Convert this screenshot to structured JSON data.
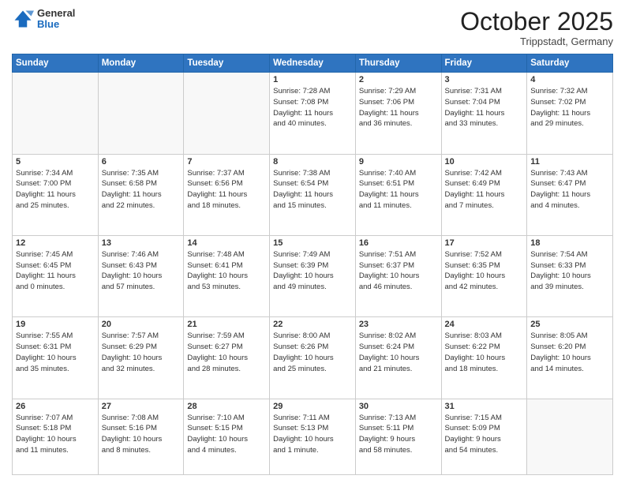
{
  "header": {
    "logo": {
      "general": "General",
      "blue": "Blue"
    },
    "title": "October 2025",
    "location": "Trippstadt, Germany"
  },
  "weekdays": [
    "Sunday",
    "Monday",
    "Tuesday",
    "Wednesday",
    "Thursday",
    "Friday",
    "Saturday"
  ],
  "weeks": [
    [
      {
        "day": "",
        "info": ""
      },
      {
        "day": "",
        "info": ""
      },
      {
        "day": "",
        "info": ""
      },
      {
        "day": "1",
        "info": "Sunrise: 7:28 AM\nSunset: 7:08 PM\nDaylight: 11 hours\nand 40 minutes."
      },
      {
        "day": "2",
        "info": "Sunrise: 7:29 AM\nSunset: 7:06 PM\nDaylight: 11 hours\nand 36 minutes."
      },
      {
        "day": "3",
        "info": "Sunrise: 7:31 AM\nSunset: 7:04 PM\nDaylight: 11 hours\nand 33 minutes."
      },
      {
        "day": "4",
        "info": "Sunrise: 7:32 AM\nSunset: 7:02 PM\nDaylight: 11 hours\nand 29 minutes."
      }
    ],
    [
      {
        "day": "5",
        "info": "Sunrise: 7:34 AM\nSunset: 7:00 PM\nDaylight: 11 hours\nand 25 minutes."
      },
      {
        "day": "6",
        "info": "Sunrise: 7:35 AM\nSunset: 6:58 PM\nDaylight: 11 hours\nand 22 minutes."
      },
      {
        "day": "7",
        "info": "Sunrise: 7:37 AM\nSunset: 6:56 PM\nDaylight: 11 hours\nand 18 minutes."
      },
      {
        "day": "8",
        "info": "Sunrise: 7:38 AM\nSunset: 6:54 PM\nDaylight: 11 hours\nand 15 minutes."
      },
      {
        "day": "9",
        "info": "Sunrise: 7:40 AM\nSunset: 6:51 PM\nDaylight: 11 hours\nand 11 minutes."
      },
      {
        "day": "10",
        "info": "Sunrise: 7:42 AM\nSunset: 6:49 PM\nDaylight: 11 hours\nand 7 minutes."
      },
      {
        "day": "11",
        "info": "Sunrise: 7:43 AM\nSunset: 6:47 PM\nDaylight: 11 hours\nand 4 minutes."
      }
    ],
    [
      {
        "day": "12",
        "info": "Sunrise: 7:45 AM\nSunset: 6:45 PM\nDaylight: 11 hours\nand 0 minutes."
      },
      {
        "day": "13",
        "info": "Sunrise: 7:46 AM\nSunset: 6:43 PM\nDaylight: 10 hours\nand 57 minutes."
      },
      {
        "day": "14",
        "info": "Sunrise: 7:48 AM\nSunset: 6:41 PM\nDaylight: 10 hours\nand 53 minutes."
      },
      {
        "day": "15",
        "info": "Sunrise: 7:49 AM\nSunset: 6:39 PM\nDaylight: 10 hours\nand 49 minutes."
      },
      {
        "day": "16",
        "info": "Sunrise: 7:51 AM\nSunset: 6:37 PM\nDaylight: 10 hours\nand 46 minutes."
      },
      {
        "day": "17",
        "info": "Sunrise: 7:52 AM\nSunset: 6:35 PM\nDaylight: 10 hours\nand 42 minutes."
      },
      {
        "day": "18",
        "info": "Sunrise: 7:54 AM\nSunset: 6:33 PM\nDaylight: 10 hours\nand 39 minutes."
      }
    ],
    [
      {
        "day": "19",
        "info": "Sunrise: 7:55 AM\nSunset: 6:31 PM\nDaylight: 10 hours\nand 35 minutes."
      },
      {
        "day": "20",
        "info": "Sunrise: 7:57 AM\nSunset: 6:29 PM\nDaylight: 10 hours\nand 32 minutes."
      },
      {
        "day": "21",
        "info": "Sunrise: 7:59 AM\nSunset: 6:27 PM\nDaylight: 10 hours\nand 28 minutes."
      },
      {
        "day": "22",
        "info": "Sunrise: 8:00 AM\nSunset: 6:26 PM\nDaylight: 10 hours\nand 25 minutes."
      },
      {
        "day": "23",
        "info": "Sunrise: 8:02 AM\nSunset: 6:24 PM\nDaylight: 10 hours\nand 21 minutes."
      },
      {
        "day": "24",
        "info": "Sunrise: 8:03 AM\nSunset: 6:22 PM\nDaylight: 10 hours\nand 18 minutes."
      },
      {
        "day": "25",
        "info": "Sunrise: 8:05 AM\nSunset: 6:20 PM\nDaylight: 10 hours\nand 14 minutes."
      }
    ],
    [
      {
        "day": "26",
        "info": "Sunrise: 7:07 AM\nSunset: 5:18 PM\nDaylight: 10 hours\nand 11 minutes."
      },
      {
        "day": "27",
        "info": "Sunrise: 7:08 AM\nSunset: 5:16 PM\nDaylight: 10 hours\nand 8 minutes."
      },
      {
        "day": "28",
        "info": "Sunrise: 7:10 AM\nSunset: 5:15 PM\nDaylight: 10 hours\nand 4 minutes."
      },
      {
        "day": "29",
        "info": "Sunrise: 7:11 AM\nSunset: 5:13 PM\nDaylight: 10 hours\nand 1 minute."
      },
      {
        "day": "30",
        "info": "Sunrise: 7:13 AM\nSunset: 5:11 PM\nDaylight: 9 hours\nand 58 minutes."
      },
      {
        "day": "31",
        "info": "Sunrise: 7:15 AM\nSunset: 5:09 PM\nDaylight: 9 hours\nand 54 minutes."
      },
      {
        "day": "",
        "info": ""
      }
    ]
  ],
  "colors": {
    "header_bg": "#2f74c0",
    "header_text": "#ffffff",
    "border": "#cccccc"
  }
}
